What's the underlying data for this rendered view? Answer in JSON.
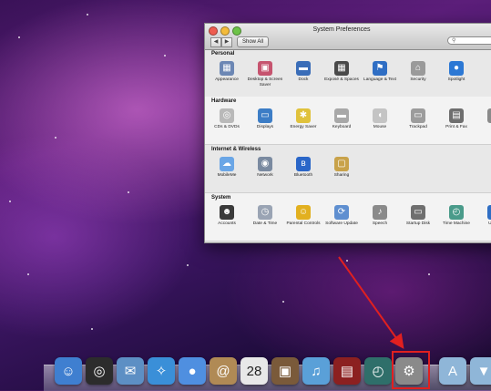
{
  "window": {
    "title": "System Preferences",
    "show_all_label": "Show All",
    "nav_back": "◀",
    "nav_forward": "▶",
    "search_icon": "magnifier-icon"
  },
  "sections": [
    {
      "label": "Personal",
      "panes": [
        {
          "label": "Appearance",
          "icon": "appearance-icon",
          "glyph": "▦",
          "color": "#6c87b4"
        },
        {
          "label": "Desktop & Screen Saver",
          "icon": "desktop-icon",
          "glyph": "▣",
          "color": "#c6546f"
        },
        {
          "label": "Dock",
          "icon": "dock-icon",
          "glyph": "▬",
          "color": "#3a6db8"
        },
        {
          "label": "Exposé & Spaces",
          "icon": "expose-icon",
          "glyph": "▦",
          "color": "#4a4a4a"
        },
        {
          "label": "Language & Text",
          "icon": "language-icon",
          "glyph": "⚑",
          "color": "#2f6ec4"
        },
        {
          "label": "Security",
          "icon": "security-icon",
          "glyph": "⌂",
          "color": "#9a9a9a"
        },
        {
          "label": "Spotlight",
          "icon": "spotlight-icon",
          "glyph": "●",
          "color": "#2c78d4"
        }
      ]
    },
    {
      "label": "Hardware",
      "panes": [
        {
          "label": "CDs & DVDs",
          "icon": "cds-icon",
          "glyph": "◎",
          "color": "#b9b9b9"
        },
        {
          "label": "Displays",
          "icon": "displays-icon",
          "glyph": "▭",
          "color": "#3c7dc6"
        },
        {
          "label": "Energy Saver",
          "icon": "energy-saver-icon",
          "glyph": "✱",
          "color": "#e0c23c"
        },
        {
          "label": "Keyboard",
          "icon": "keyboard-icon",
          "glyph": "▬",
          "color": "#a8a8a8"
        },
        {
          "label": "Mouse",
          "icon": "mouse-icon",
          "glyph": "◖",
          "color": "#c4c4c4"
        },
        {
          "label": "Trackpad",
          "icon": "trackpad-icon",
          "glyph": "▭",
          "color": "#9c9c9c"
        },
        {
          "label": "Print & Fax",
          "icon": "printer-icon",
          "glyph": "▤",
          "color": "#6e6e6e"
        },
        {
          "label": "S",
          "icon": "sound-icon",
          "glyph": "◐",
          "color": "#8a8a8a"
        }
      ]
    },
    {
      "label": "Internet & Wireless",
      "panes": [
        {
          "label": "MobileMe",
          "icon": "mobileme-icon",
          "glyph": "☁",
          "color": "#6aa6e6"
        },
        {
          "label": "Network",
          "icon": "network-icon",
          "glyph": "◉",
          "color": "#7a8aa0"
        },
        {
          "label": "Bluetooth",
          "icon": "bluetooth-icon",
          "glyph": "ʙ",
          "color": "#2a66c8"
        },
        {
          "label": "Sharing",
          "icon": "sharing-icon",
          "glyph": "▢",
          "color": "#c8a24a"
        }
      ]
    },
    {
      "label": "System",
      "panes": [
        {
          "label": "Accounts",
          "icon": "accounts-icon",
          "glyph": "☻",
          "color": "#3a3a3a"
        },
        {
          "label": "Date & Time",
          "icon": "date-time-icon",
          "glyph": "◷",
          "color": "#9aa4b4"
        },
        {
          "label": "Parental Controls",
          "icon": "parental-controls-icon",
          "glyph": "☺",
          "color": "#e2b020"
        },
        {
          "label": "Software Update",
          "icon": "software-update-icon",
          "glyph": "⟳",
          "color": "#5f8fd0"
        },
        {
          "label": "Speech",
          "icon": "speech-icon",
          "glyph": "♪",
          "color": "#8a8a8a"
        },
        {
          "label": "Startup Disk",
          "icon": "startup-disk-icon",
          "glyph": "▭",
          "color": "#6f6f6f"
        },
        {
          "label": "Time Machine",
          "icon": "time-machine-icon",
          "glyph": "◴",
          "color": "#4a9b8a"
        },
        {
          "label": "Uni Ac",
          "icon": "universal-access-icon",
          "glyph": "☉",
          "color": "#2f6ec4"
        }
      ]
    }
  ],
  "dock": [
    {
      "name": "finder",
      "icon": "finder-icon",
      "glyph": "☺",
      "color": "#3f7fd0"
    },
    {
      "name": "dashboard",
      "icon": "dashboard-icon",
      "glyph": "◎",
      "color": "#2c2c2c"
    },
    {
      "name": "mail",
      "icon": "mail-icon",
      "glyph": "✉",
      "color": "#5d8fc4"
    },
    {
      "name": "safari",
      "icon": "safari-icon",
      "glyph": "✧",
      "color": "#3a8fd8"
    },
    {
      "name": "ichat",
      "icon": "ichat-icon",
      "glyph": "●",
      "color": "#4f8fe0"
    },
    {
      "name": "address-book",
      "icon": "address-book-icon",
      "glyph": "@",
      "color": "#b08a55"
    },
    {
      "name": "ical",
      "icon": "ical-icon",
      "glyph": "28",
      "color": "#e8e8e8"
    },
    {
      "name": "iphoto",
      "icon": "iphoto-icon",
      "glyph": "▣",
      "color": "#7a5a3a"
    },
    {
      "name": "itunes",
      "icon": "itunes-icon",
      "glyph": "♫",
      "color": "#5aa0d8"
    },
    {
      "name": "photo-booth",
      "icon": "photo-booth-icon",
      "glyph": "▤",
      "color": "#8c2020"
    },
    {
      "name": "time-machine",
      "icon": "time-machine-dock-icon",
      "glyph": "◴",
      "color": "#2f6f6a"
    },
    {
      "name": "system-preferences",
      "icon": "system-preferences-icon",
      "glyph": "⚙",
      "color": "#8a8a8a"
    },
    {
      "name": "applications-folder",
      "icon": "folder-icon",
      "glyph": "A",
      "color": "#8fb6d8"
    },
    {
      "name": "downloads-folder",
      "icon": "folder-icon",
      "glyph": "▼",
      "color": "#8fb6d8"
    }
  ],
  "colors": {
    "highlight": "#e02020",
    "window_bg": "#e8e8e8"
  }
}
